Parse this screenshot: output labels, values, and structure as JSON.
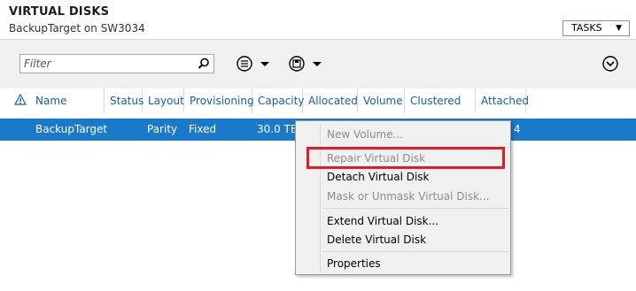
{
  "header": {
    "title": "VIRTUAL DISKS",
    "subtitle": "BackupTarget on SW3034",
    "tasks_label": "TASKS"
  },
  "toolbar": {
    "filter_placeholder": "Filter"
  },
  "table": {
    "columns": [
      "Name",
      "Status",
      "Layout",
      "Provisioning",
      "Capacity",
      "Allocated",
      "Volume",
      "Clustered",
      "Attached"
    ],
    "rows": [
      {
        "name": "BackupTarget",
        "status": "",
        "layout": "Parity",
        "provisioning": "Fixed",
        "capacity": "30.0 TB",
        "attached_partial": "4"
      }
    ]
  },
  "context_menu": {
    "items": [
      {
        "label": "New Volume...",
        "enabled": false
      },
      {
        "label": "Repair Virtual Disk",
        "enabled": false
      },
      {
        "label": "Detach Virtual Disk",
        "enabled": true
      },
      {
        "label": "Mask or Unmask Virtual Disk...",
        "enabled": false
      },
      {
        "label": "Extend Virtual Disk...",
        "enabled": true
      },
      {
        "label": "Delete Virtual Disk",
        "enabled": true
      },
      {
        "label": "Properties",
        "enabled": true
      }
    ]
  },
  "colors": {
    "selection": "#1979ca",
    "header_link": "#1a5fa0",
    "highlight": "#e31b23"
  }
}
